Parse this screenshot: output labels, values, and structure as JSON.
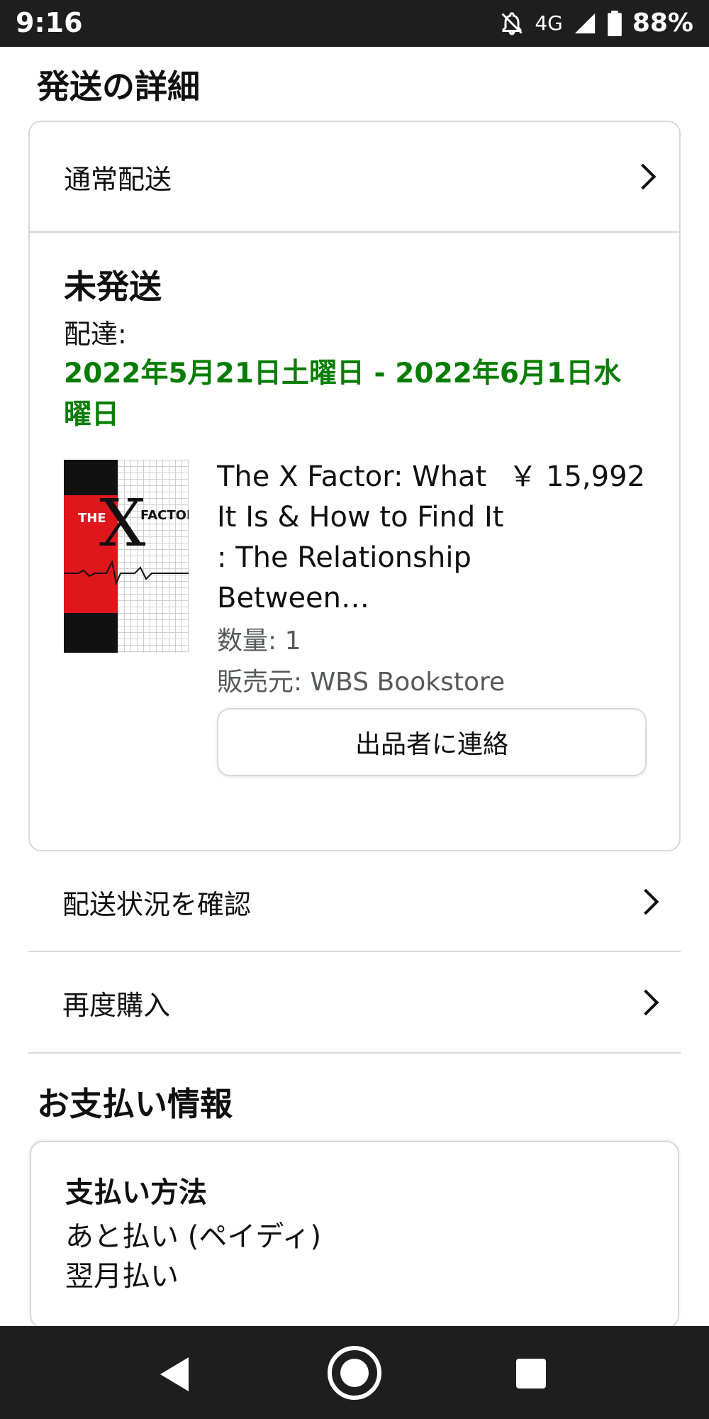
{
  "status_bar": {
    "time": "9:16",
    "network": "4G",
    "battery": "88%",
    "icons": [
      "notifications-off-icon",
      "signal-icon",
      "battery-icon"
    ]
  },
  "shipping": {
    "heading": "発送の詳細",
    "method": "通常配送",
    "status": "未発送",
    "delivery_label": "配達:",
    "delivery_date": "2022年5月21日土曜日 - 2022年6月1日水曜日",
    "item": {
      "cover_text": {
        "the": "THE",
        "x": "X",
        "factor": "FACTOR"
      },
      "title": "The X Factor: What It Is & How to Find It : The Relationship Between…",
      "price": "￥ 15,992",
      "quantity": "数量: 1",
      "seller": "販売元: WBS Bookstore",
      "contact_button": "出品者に連絡"
    }
  },
  "actions": {
    "track": "配送状況を確認",
    "buy_again": "再度購入"
  },
  "payment": {
    "heading": "お支払い情報",
    "method_label": "支払い方法",
    "method": "あと払い (ペイディ)",
    "plan": "翌月払い"
  },
  "colors": {
    "delivery_green": "#067d00",
    "bar_dark": "#1e1e1e",
    "border": "#d5d9d9"
  },
  "nav_bar": {
    "icons": [
      "back-icon",
      "home-icon",
      "recents-icon"
    ]
  }
}
